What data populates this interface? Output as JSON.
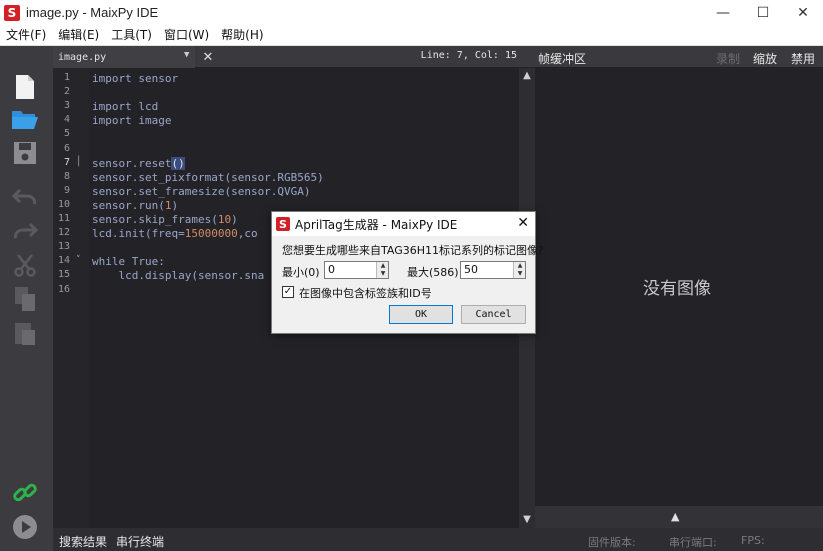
{
  "window": {
    "title": "image.py - MaixPy IDE",
    "logo": "S",
    "minimize": "—",
    "maximize": "☐",
    "close": "✕"
  },
  "menu": [
    "文件(F)",
    "编辑(E)",
    "工具(T)",
    "窗口(W)",
    "帮助(H)"
  ],
  "toolbar": {
    "icons": [
      "new-file-icon",
      "open-folder-icon",
      "save-icon",
      "undo-icon",
      "redo-icon",
      "cut-icon",
      "copy-icon",
      "paste-icon",
      "connect-icon",
      "run-icon"
    ]
  },
  "editor": {
    "tab_name": "image.py",
    "tab_arrow": "▼",
    "tab_close": "✕",
    "cursor_position": "Line: 7, Col: 15",
    "current_line": 7,
    "lines": [
      {
        "n": "1",
        "text": "import sensor"
      },
      {
        "n": "2",
        "text": ""
      },
      {
        "n": "3",
        "text": "import lcd"
      },
      {
        "n": "4",
        "text": "import image"
      },
      {
        "n": "5",
        "text": ""
      },
      {
        "n": "6",
        "text": ""
      },
      {
        "n": "7",
        "text": "sensor.reset()"
      },
      {
        "n": "8",
        "text": "sensor.set_pixformat(sensor.RGB565)"
      },
      {
        "n": "9",
        "text": "sensor.set_framesize(sensor.QVGA)"
      },
      {
        "n": "10",
        "text": "sensor.run(1)"
      },
      {
        "n": "11",
        "text": "sensor.skip_frames(10)"
      },
      {
        "n": "12",
        "text": "lcd.init(freq=15000000,co"
      },
      {
        "n": "13",
        "text": ""
      },
      {
        "n": "14",
        "text": "while True:"
      },
      {
        "n": "15",
        "text": "    lcd.display(sensor.sna"
      },
      {
        "n": "16",
        "text": ""
      }
    ],
    "fold_markers": {
      "7": "│",
      "14": "˅"
    }
  },
  "framebuffer": {
    "title": "帧缓冲区",
    "record": "录制",
    "zoom": "缩放",
    "disable": "禁用",
    "placeholder": "没有图像",
    "up_arrow": "▲"
  },
  "statusbar": {
    "search_results": "搜索结果",
    "serial_terminal": "串行终端",
    "firmware_label": "固件版本:",
    "serial_port_label": "串行端口:",
    "fps_label": "FPS:"
  },
  "dialog": {
    "logo": "S",
    "title": "AprilTag生成器 - MaixPy IDE",
    "close": "✕",
    "prompt": "您想要生成哪些来自TAG36H11标记系列的标记图像?",
    "min_label": "最小(0)",
    "min_value": "0",
    "max_label": "最大(586)",
    "max_value": "50",
    "checkbox_checked": true,
    "checkbox_mark": "✓",
    "checkbox_label": "在图像中包含标签族和ID号",
    "ok": "OK",
    "cancel": "Cancel"
  }
}
